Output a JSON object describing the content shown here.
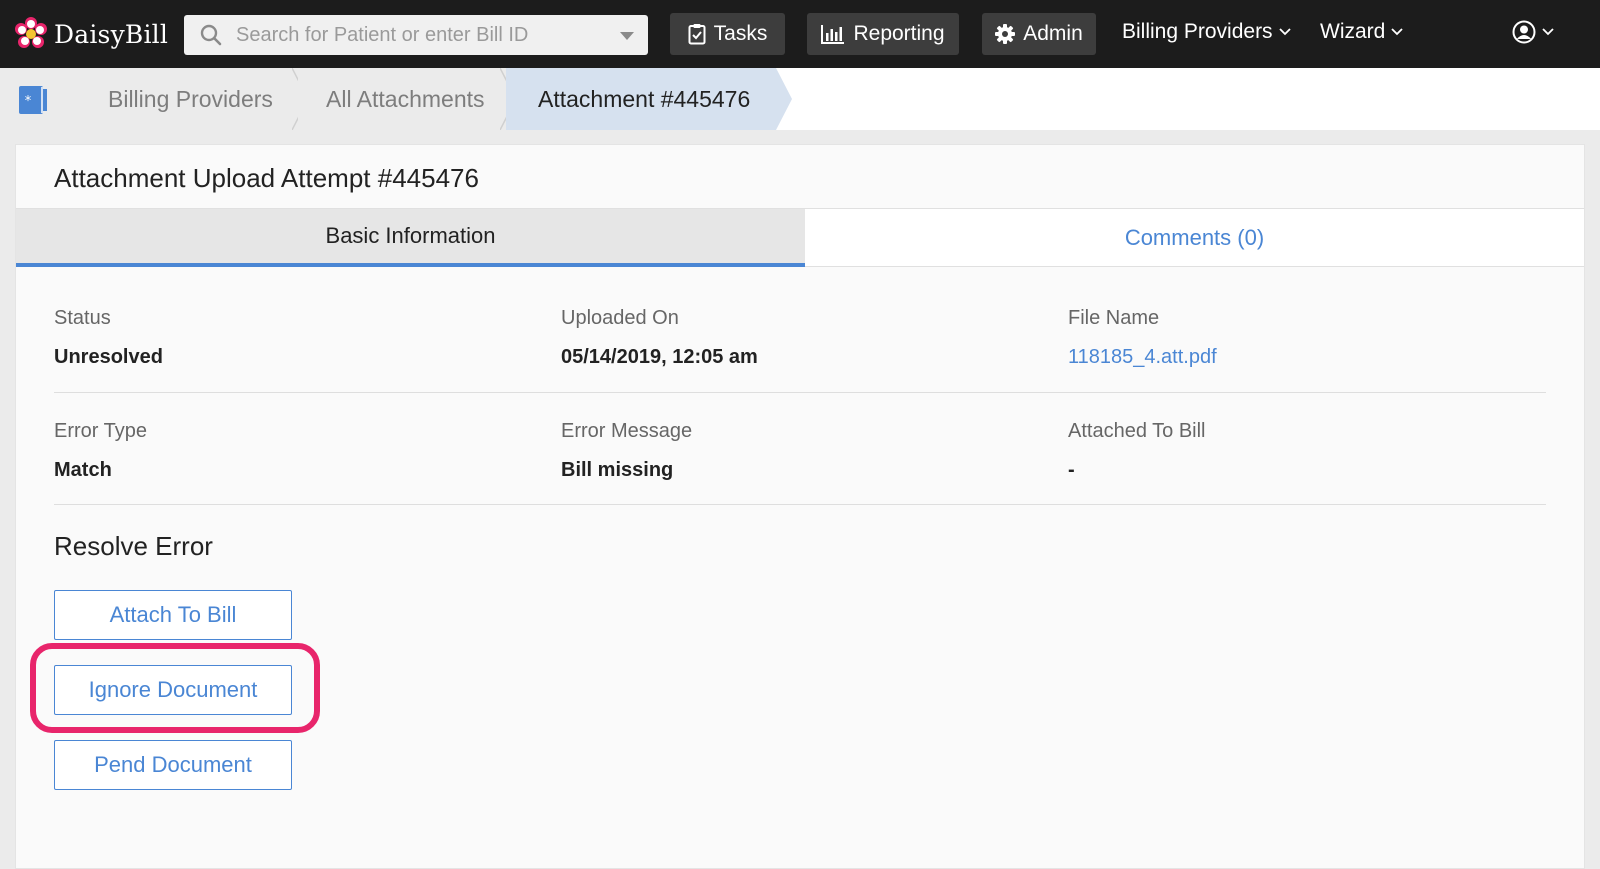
{
  "brand": {
    "name": "DaisyBill"
  },
  "search": {
    "placeholder": "Search for Patient or enter Bill ID"
  },
  "nav": {
    "tasks_label": "Tasks",
    "reporting_label": "Reporting",
    "admin_label": "Admin",
    "billing_providers_label": "Billing Providers",
    "wizard_label": "Wizard"
  },
  "breadcrumb": {
    "items": [
      "Billing Providers",
      "All Attachments",
      "Attachment #445476"
    ]
  },
  "page": {
    "title": "Attachment Upload Attempt #445476",
    "tabs": [
      "Basic Information",
      "Comments (0)"
    ]
  },
  "fields": {
    "status": {
      "label": "Status",
      "value": "Unresolved"
    },
    "uploaded_on": {
      "label": "Uploaded On",
      "value": "05/14/2019, 12:05 am"
    },
    "file_name": {
      "label": "File Name",
      "value": "118185_4.att.pdf"
    },
    "error_type": {
      "label": "Error Type",
      "value": "Match"
    },
    "error_message": {
      "label": "Error Message",
      "value": "Bill missing"
    },
    "attached_to_bill": {
      "label": "Attached To Bill",
      "value": "-"
    }
  },
  "resolve": {
    "title": "Resolve Error",
    "attach_label": "Attach To Bill",
    "ignore_label": "Ignore Document",
    "pend_label": "Pend Document"
  },
  "colors": {
    "accent": "#4a86d4",
    "highlight": "#e8256b",
    "nav_background": "#1c1c1c",
    "active_crumb": "#d6e1ef"
  },
  "icons": {
    "logo": "daisy-flower-icon",
    "search": "search-icon",
    "tasks": "clipboard-check-icon",
    "reporting": "bar-chart-icon",
    "admin": "gear-icon",
    "account": "user-circle-icon",
    "home": "home-card-icon"
  }
}
